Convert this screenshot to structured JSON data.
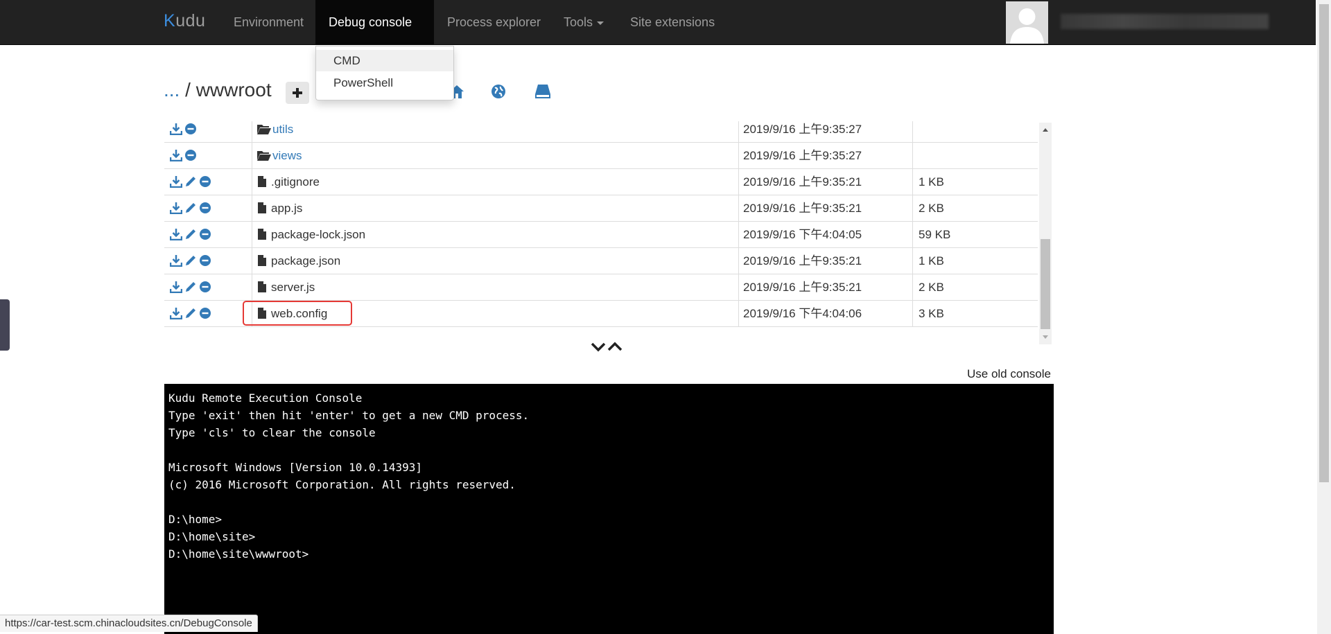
{
  "nav": {
    "brand_k": "K",
    "brand_rest": "udu",
    "items": [
      {
        "label": "Environment"
      },
      {
        "label": "Debug console"
      },
      {
        "label": "Process explorer"
      },
      {
        "label": "Tools"
      },
      {
        "label": "Site extensions"
      }
    ]
  },
  "dropdown": {
    "items": [
      {
        "label": "CMD"
      },
      {
        "label": "PowerShell"
      }
    ]
  },
  "breadcrumb": {
    "ellipsis": "...",
    "separator": "/",
    "current": "wwwroot"
  },
  "files": {
    "rows": [
      {
        "name": "utils",
        "date": "2019/9/16 上午9:35:27",
        "size": "",
        "type": "folder"
      },
      {
        "name": "views",
        "date": "2019/9/16 上午9:35:27",
        "size": "",
        "type": "folder"
      },
      {
        "name": ".gitignore",
        "date": "2019/9/16 上午9:35:21",
        "size": "1 KB",
        "type": "file"
      },
      {
        "name": "app.js",
        "date": "2019/9/16 上午9:35:21",
        "size": "2 KB",
        "type": "file"
      },
      {
        "name": "package-lock.json",
        "date": "2019/9/16 下午4:04:05",
        "size": "59 KB",
        "type": "file"
      },
      {
        "name": "package.json",
        "date": "2019/9/16 上午9:35:21",
        "size": "1 KB",
        "type": "file"
      },
      {
        "name": "server.js",
        "date": "2019/9/16 上午9:35:21",
        "size": "2 KB",
        "type": "file"
      },
      {
        "name": "web.config",
        "date": "2019/9/16 下午4:04:06",
        "size": "3 KB",
        "type": "file"
      }
    ]
  },
  "console": {
    "use_old_label": "Use old console",
    "lines": [
      "Kudu Remote Execution Console",
      "Type 'exit' then hit 'enter' to get a new CMD process.",
      "Type 'cls' to clear the console",
      "",
      "Microsoft Windows [Version 10.0.14393]",
      "(c) 2016 Microsoft Corporation. All rights reserved.",
      "",
      "D:\\home>",
      "D:\\home\\site>",
      "D:\\home\\site\\wwwroot>"
    ]
  },
  "status_url": "https://car-test.scm.chinacloudsites.cn/DebugConsole",
  "colors": {
    "link": "#337ab7",
    "navbar": "#222222",
    "highlight": "#e53935"
  }
}
